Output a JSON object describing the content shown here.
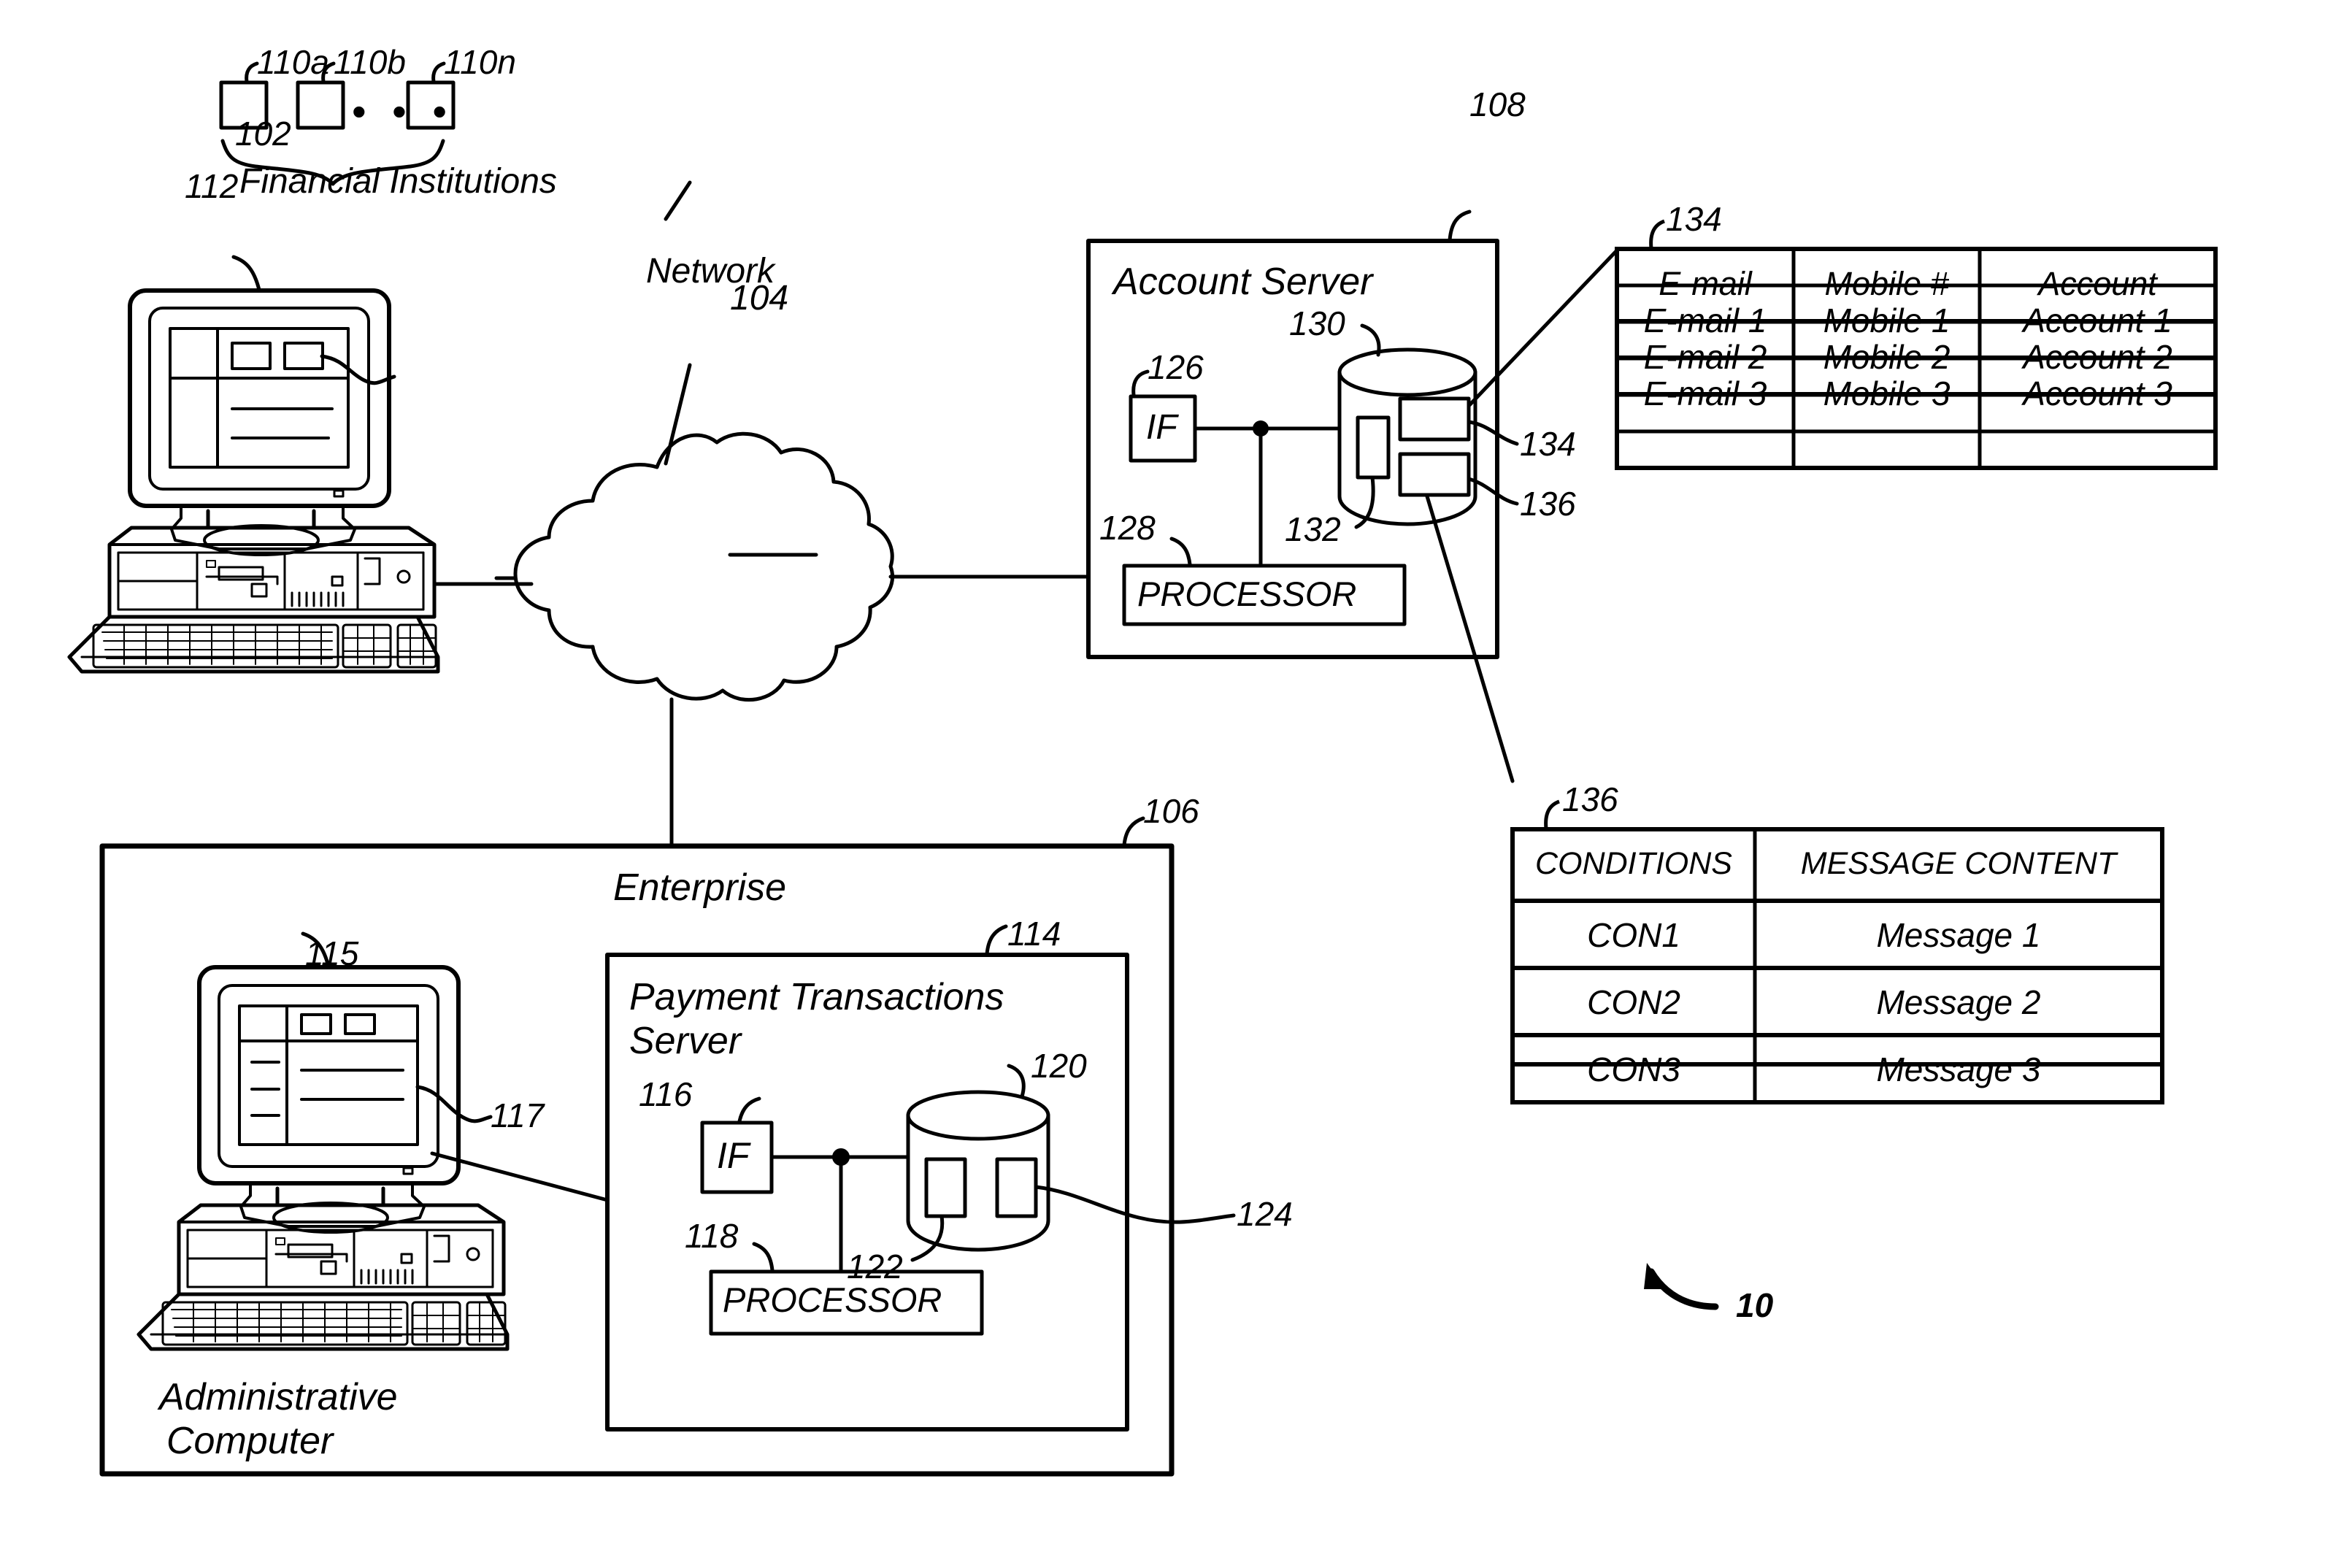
{
  "figure": {
    "figure_ref": "10",
    "domain_note": "patent system architecture diagram"
  },
  "nodes": {
    "user_computer": {
      "ref": "102",
      "screen_ref": "112"
    },
    "financial_institutions": {
      "label": "Financial Institutions",
      "boxes": [
        {
          "ref": "110a"
        },
        {
          "ref": "110b"
        },
        {
          "ref": "110n"
        }
      ],
      "ellipsis": "• • •"
    },
    "network": {
      "label": "Network",
      "ref": "104"
    },
    "account_server": {
      "title": "Account Server",
      "ref": "108",
      "interface_label": "IF",
      "interface_ref": "126",
      "processor_label": "PROCESSOR",
      "processor_ref": "128",
      "database_ref": "130",
      "store_a_ref": "132",
      "store_b_ref": "134",
      "store_c_ref": "136"
    },
    "enterprise": {
      "title": "Enterprise",
      "ref": "106"
    },
    "administrative_computer": {
      "label_line1": "Administrative",
      "label_line2": "Computer",
      "ref": "115",
      "screen_ref": "117"
    },
    "payment_transactions_server": {
      "title_line1": "Payment Transactions",
      "title_line2": "Server",
      "ref": "114",
      "interface_label": "IF",
      "interface_ref": "116",
      "processor_label": "PROCESSOR",
      "processor_ref": "118",
      "database_ref": "120",
      "store_a_ref": "122",
      "store_b_ref": "124"
    }
  },
  "tables": {
    "accounts": {
      "ref": "134",
      "headers": [
        "E-mail",
        "Mobile #",
        "Account"
      ],
      "rows": [
        [
          "E-mail 1",
          "Mobile 1",
          "Account 1"
        ],
        [
          "E-mail 2",
          "Mobile 2",
          "Account 2"
        ],
        [
          "E-mail 3",
          "Mobile 3",
          "Account 3"
        ]
      ]
    },
    "messages": {
      "ref": "136",
      "headers": [
        "CONDITIONS",
        "MESSAGE CONTENT"
      ],
      "rows": [
        [
          "CON1",
          "Message 1"
        ],
        [
          "CON2",
          "Message 2"
        ],
        [
          "CON3",
          "Message 3"
        ]
      ]
    }
  },
  "colors": {
    "ink": "#000000",
    "paper": "#ffffff"
  }
}
